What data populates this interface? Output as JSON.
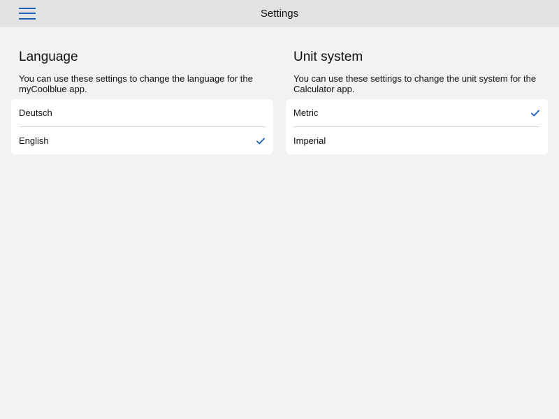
{
  "header": {
    "title": "Settings",
    "menu_icon": "hamburger-menu-icon"
  },
  "colors": {
    "accent": "#1a5fb4",
    "background": "#f2f2f2",
    "header_bg": "#e2e2e2",
    "card_bg": "#ffffff"
  },
  "language": {
    "heading": "Language",
    "description": "You can use these settings to change the language for the myCoolblue app.",
    "options": [
      {
        "label": "Deutsch",
        "selected": false
      },
      {
        "label": "English",
        "selected": true
      }
    ]
  },
  "unit_system": {
    "heading": "Unit system",
    "description": "You can use these settings to change the unit system for the Calculator app.",
    "options": [
      {
        "label": "Metric",
        "selected": true
      },
      {
        "label": "Imperial",
        "selected": false
      }
    ]
  },
  "icons": {
    "checkmark": "checkmark-icon"
  }
}
